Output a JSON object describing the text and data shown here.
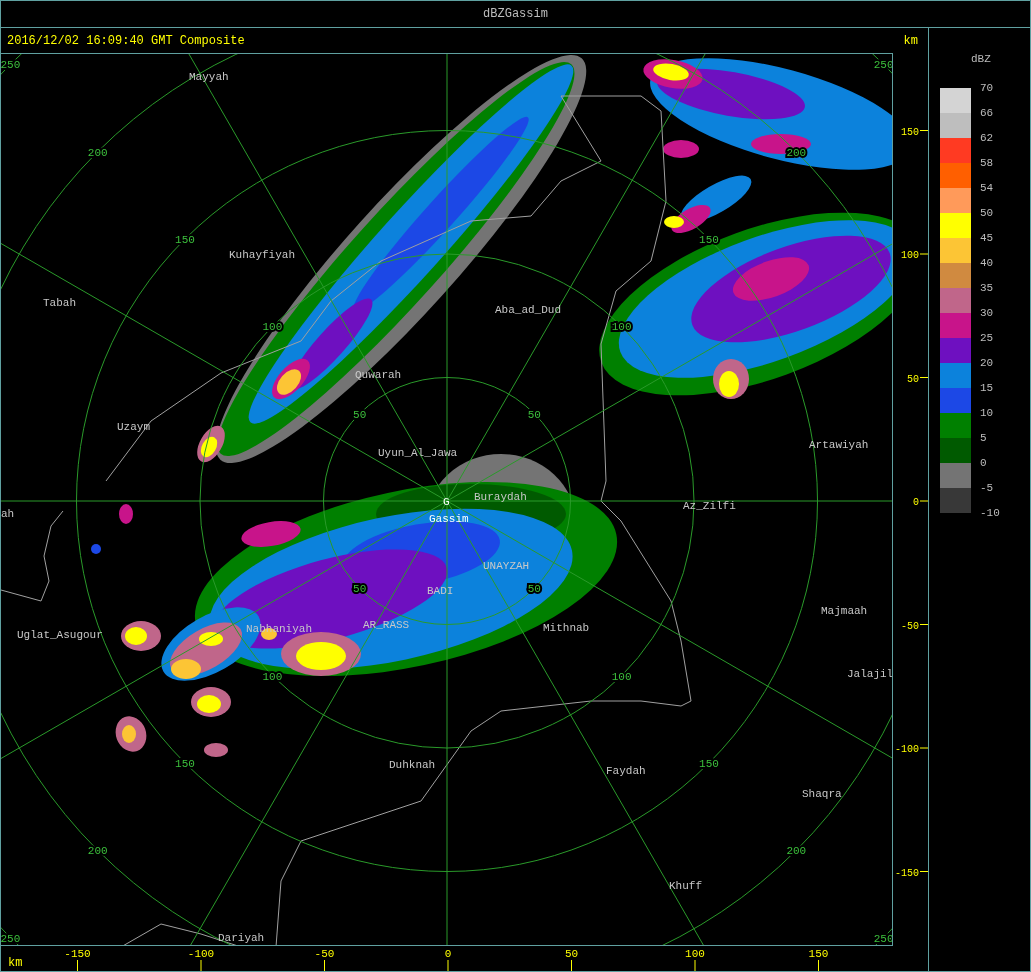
{
  "window": {
    "title": "dBZGassim"
  },
  "header": {
    "timestamp": "2016/12/02 16:09:40 GMT Composite",
    "axis_unit": "km"
  },
  "map": {
    "range_rings": [
      {
        "labels": [
          "50",
          "50",
          "50",
          "50"
        ]
      },
      {
        "labels": [
          "100",
          "100",
          "100",
          "100"
        ]
      },
      {
        "labels": [
          "150",
          "150",
          "150",
          "150"
        ]
      },
      {
        "labels": [
          "200",
          "200",
          "200",
          "200"
        ]
      },
      {
        "labels": [
          "250",
          "250",
          "250",
          "250"
        ]
      }
    ],
    "places": [
      {
        "name": "Mayyah",
        "kind": "town"
      },
      {
        "name": "Kuhayfiyah",
        "kind": "town"
      },
      {
        "name": "Tabah",
        "kind": "town"
      },
      {
        "name": "Aba_ad_Dud",
        "kind": "town"
      },
      {
        "name": "Quwarah",
        "kind": "town"
      },
      {
        "name": "Uzaym",
        "kind": "town"
      },
      {
        "name": "Uyun_Al_Jawa",
        "kind": "town"
      },
      {
        "name": "Artawiyah",
        "kind": "town"
      },
      {
        "name": "ah",
        "kind": "town"
      },
      {
        "name": "G",
        "kind": "site"
      },
      {
        "name": "Buraydah",
        "kind": "town"
      },
      {
        "name": "Az_Zilfi",
        "kind": "town"
      },
      {
        "name": "Gassim",
        "kind": "site"
      },
      {
        "name": "UNAYZAH",
        "kind": "town"
      },
      {
        "name": "BADI",
        "kind": "town"
      },
      {
        "name": "Uglat_Asugour",
        "kind": "town"
      },
      {
        "name": "Nabhaniyah",
        "kind": "town"
      },
      {
        "name": "AR_RASS",
        "kind": "town"
      },
      {
        "name": "Mithnab",
        "kind": "town"
      },
      {
        "name": "Majmaah",
        "kind": "town"
      },
      {
        "name": "Jalajil",
        "kind": "town"
      },
      {
        "name": "Duhknah",
        "kind": "town"
      },
      {
        "name": "Faydah",
        "kind": "town"
      },
      {
        "name": "Shaqra",
        "kind": "town"
      },
      {
        "name": "Khuff",
        "kind": "town"
      },
      {
        "name": "Dariyah",
        "kind": "town"
      }
    ]
  },
  "y_axis": {
    "ticks": [
      "150",
      "100",
      "50",
      "0",
      "-50",
      "-100",
      "-150"
    ]
  },
  "x_axis": {
    "unit": "km",
    "ticks": [
      "-150",
      "-100",
      "-50",
      "0",
      "50",
      "100",
      "150"
    ]
  },
  "legend": {
    "unit": "dBZ",
    "bins": [
      {
        "color": "#d4d4d4"
      },
      {
        "color": "#bebebe"
      },
      {
        "color": "#ff3a22"
      },
      {
        "color": "#ff5f00"
      },
      {
        "color": "#ff9a5a"
      },
      {
        "color": "#ffff00"
      },
      {
        "color": "#fcc535"
      },
      {
        "color": "#d08a40"
      },
      {
        "color": "#c0668a"
      },
      {
        "color": "#c8148a"
      },
      {
        "color": "#6e10c0"
      },
      {
        "color": "#0c82dc"
      },
      {
        "color": "#1c48e6"
      },
      {
        "color": "#008000"
      },
      {
        "color": "#005a00"
      },
      {
        "color": "#747474"
      },
      {
        "color": "#383838"
      }
    ],
    "labels": [
      "70",
      "66",
      "62",
      "58",
      "54",
      "50",
      "45",
      "40",
      "35",
      "30",
      "25",
      "20",
      "15",
      "10",
      "5",
      "0",
      "-5",
      "-10"
    ]
  }
}
